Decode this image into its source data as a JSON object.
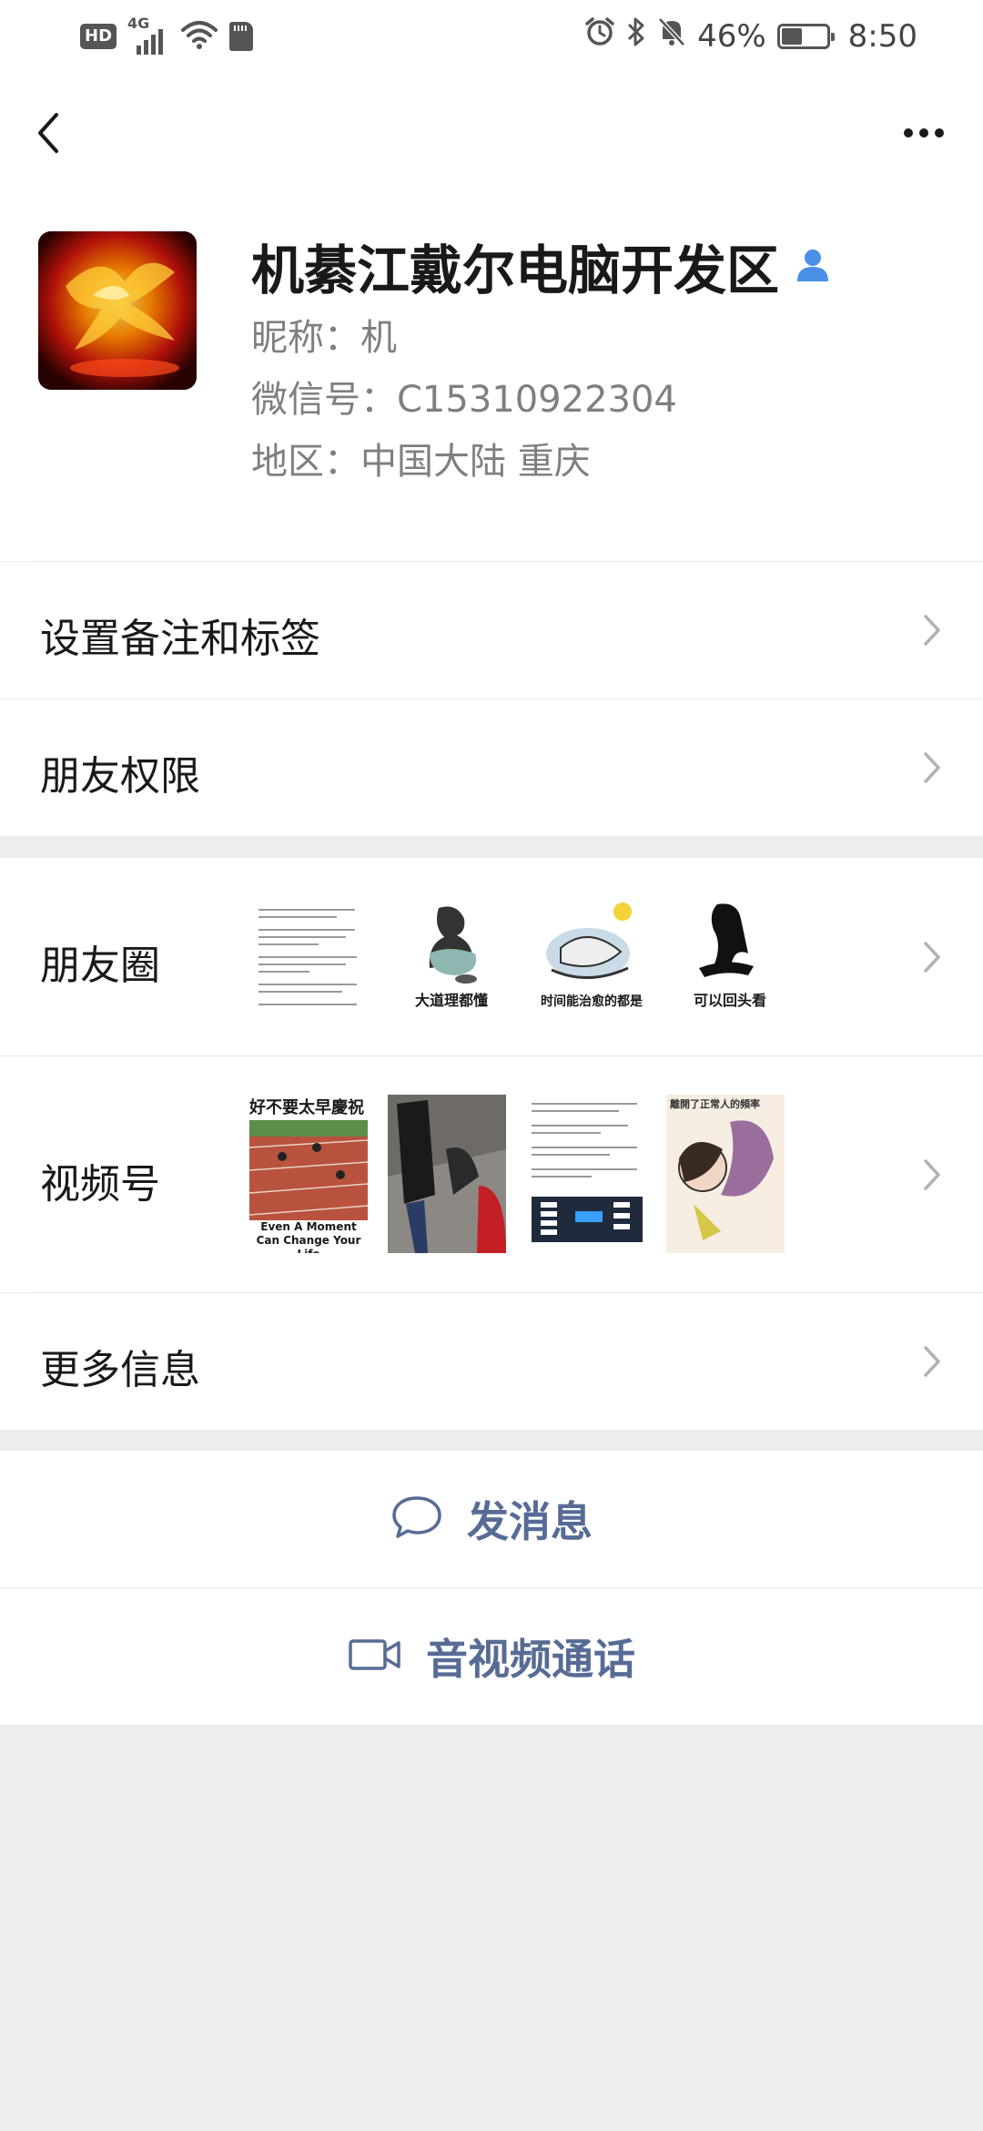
{
  "status_bar": {
    "hd": "HD",
    "network": "4G",
    "battery_text": "46%",
    "battery_level": 0.46,
    "time": "8:50",
    "icons": [
      "wifi-icon",
      "sd-card-icon",
      "alarm-icon",
      "bluetooth-icon",
      "mute-icon",
      "battery-icon"
    ]
  },
  "nav": {
    "back_icon": "chevron-left-icon",
    "more_icon": "more-dots-icon"
  },
  "profile": {
    "name": "机綦江戴尔电脑开发区",
    "nickname": "昵称：机",
    "wechat_id": "微信号：C15310922304",
    "region": "地区：中国大陆  重庆",
    "contact_icon": "person-icon",
    "accent": "#4a8fe6"
  },
  "rows": {
    "remark": "设置备注和标签",
    "permissions": "朋友权限",
    "moments": "朋友圈",
    "channels": "视频号",
    "more_info": "更多信息"
  },
  "moments_thumbs": [
    {
      "caption": ""
    },
    {
      "caption": "大道理都懂"
    },
    {
      "caption": "时间能治愈的都是"
    },
    {
      "caption": "可以回头看"
    }
  ],
  "channels_thumbs": [
    {
      "caption_top": "好不要太早慶祝",
      "caption_bottom": "Even A Moment Can Change Your Life"
    },
    {
      "caption_top": "",
      "caption_bottom": ""
    },
    {
      "caption_top": "",
      "caption_bottom": ""
    },
    {
      "caption_top": "",
      "caption_bottom": "離開了正常人的頻率"
    }
  ],
  "actions": {
    "message": "发消息",
    "call": "音视频通话",
    "link_color": "#576b95"
  }
}
